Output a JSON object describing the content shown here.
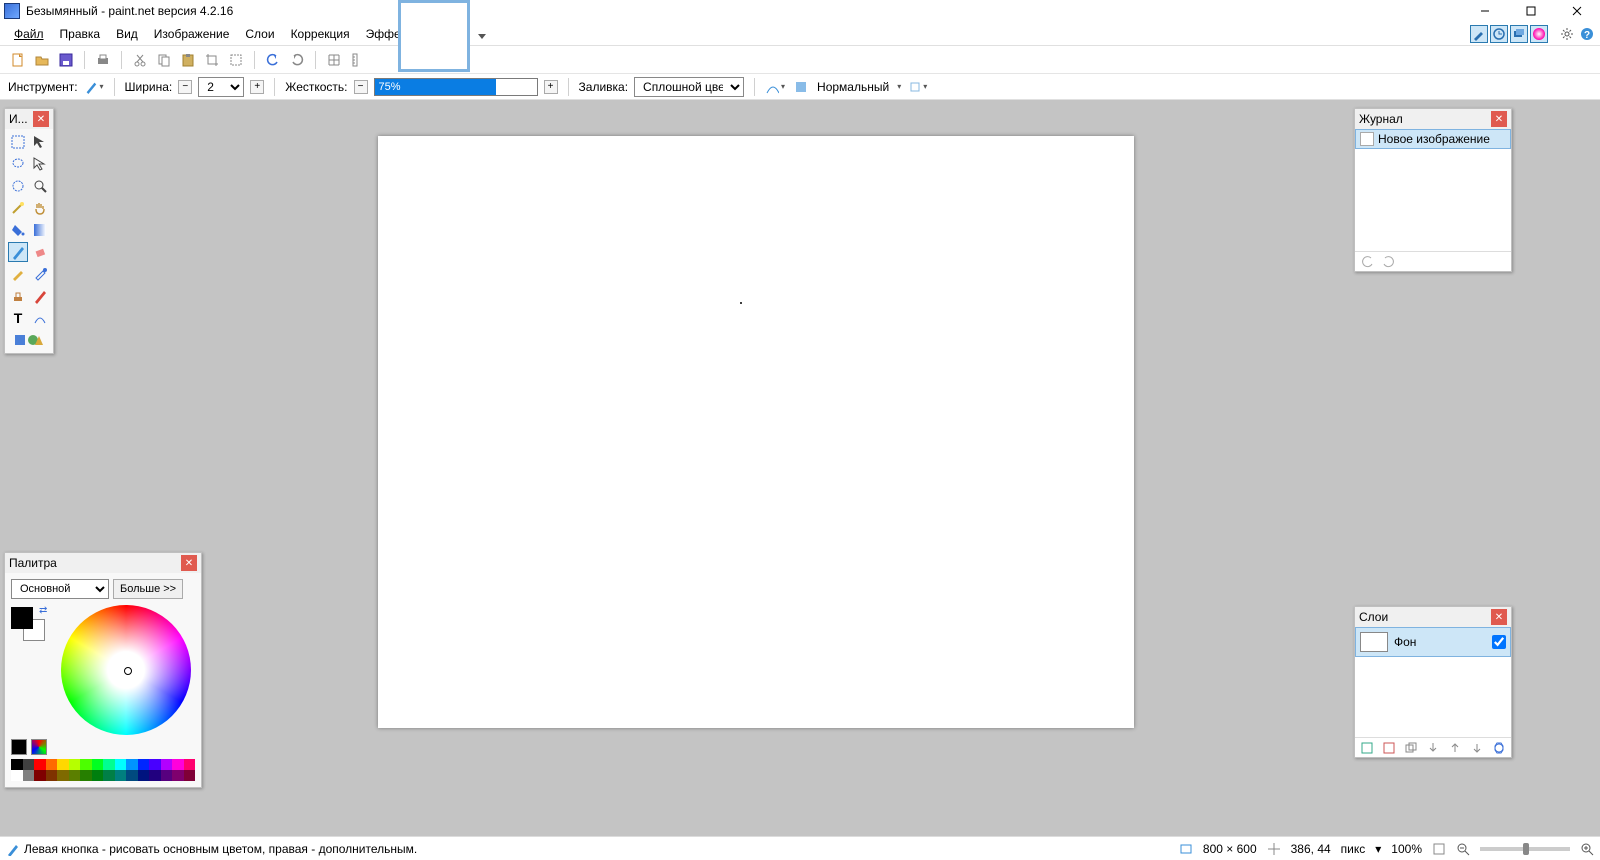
{
  "title": "Безымянный - paint.net версия 4.2.16",
  "menu": {
    "file": "Файл",
    "edit": "Правка",
    "view": "Вид",
    "image": "Изображение",
    "layers": "Слои",
    "adjustments": "Коррекция",
    "effects": "Эффекты"
  },
  "tooloptions": {
    "tool_label": "Инструмент:",
    "width_label": "Ширина:",
    "width_value": "2",
    "hardness_label": "Жесткость:",
    "hardness_value": "75%",
    "fill_label": "Заливка:",
    "fill_value": "Сплошной цвет",
    "blend_label": "Нормальный"
  },
  "tools_window": {
    "title": "И..."
  },
  "palette": {
    "title": "Палитра",
    "mode": "Основной",
    "more": "Больше >>"
  },
  "history": {
    "title": "Журнал",
    "item1": "Новое изображение"
  },
  "layers": {
    "title": "Слои",
    "layer1": "Фон"
  },
  "status": {
    "hint": "Левая кнопка - рисовать основным цветом, правая - дополнительным.",
    "size": "800 × 600",
    "pos": "386, 44",
    "unit": "пикс",
    "zoom": "100%"
  },
  "colors": {
    "strip_top": [
      "#000",
      "#404040",
      "#ff0000",
      "#ff6a00",
      "#ffd800",
      "#b6ff00",
      "#4cff00",
      "#00ff21",
      "#00ff90",
      "#00ffff",
      "#0094ff",
      "#0026ff",
      "#4800ff",
      "#b200ff",
      "#ff00dc",
      "#ff006e"
    ],
    "strip_bot": [
      "#fff",
      "#808080",
      "#7f0000",
      "#7f3300",
      "#7f6a00",
      "#5b7f00",
      "#267f00",
      "#007f0e",
      "#007f46",
      "#007f7f",
      "#004a7f",
      "#00137f",
      "#21007f",
      "#57007f",
      "#7f006e",
      "#7f0037"
    ]
  }
}
